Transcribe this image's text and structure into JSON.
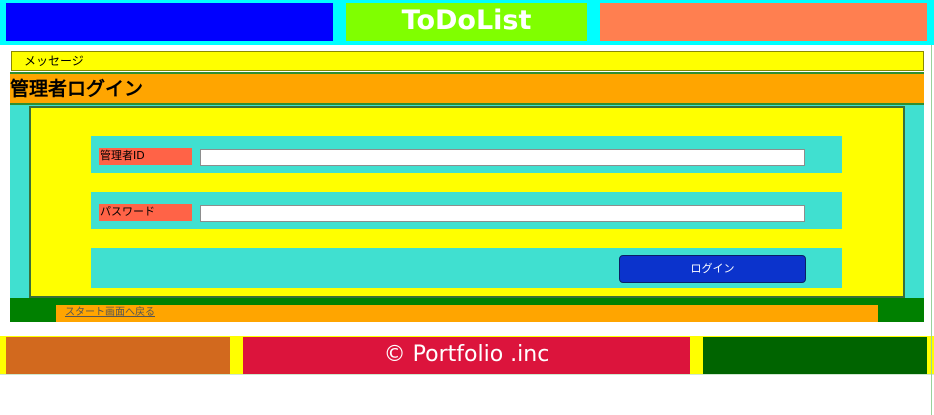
{
  "header": {
    "title": "ToDoList"
  },
  "message": {
    "text": "メッセージ"
  },
  "page": {
    "title": "管理者ログイン"
  },
  "form": {
    "admin_id_label": "管理者ID",
    "admin_id_value": "",
    "password_label": "パスワード",
    "password_value": "",
    "login_button": "ログイン"
  },
  "nav": {
    "back_link": "スタート画面へ戻る"
  },
  "footer": {
    "copyright": "© Portfolio .inc"
  },
  "colors": {
    "header_left": "#0000ff",
    "header_mid": "#80ff00",
    "header_right": "#ff7f50",
    "header_bg": "#00ffff",
    "message_bg": "#ffff00",
    "title_bg": "#ffa500",
    "form_bg": "#ffff00",
    "row_bg": "#40e0d0",
    "label_bg": "#ff6347",
    "button_bg": "#0b33cc",
    "footer_left": "#d2691e",
    "footer_mid": "#dc143c",
    "footer_right": "#006400"
  }
}
